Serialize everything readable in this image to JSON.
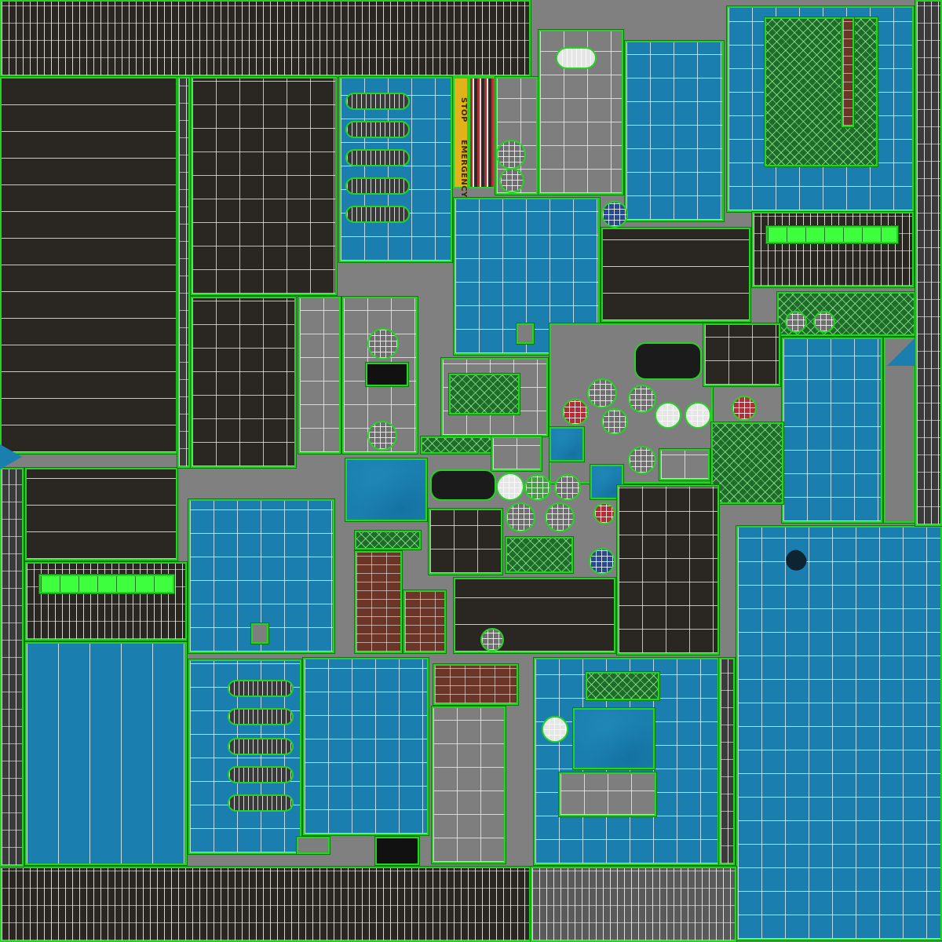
{
  "texture": {
    "label_stop": "STOP",
    "label_emergency": "EMERGENCY"
  },
  "colors": {
    "wire_green": "#23d423",
    "panel_blue": "#1a7fae",
    "panel_dark": "#2a2622",
    "panel_gray": "#7e7e7e",
    "warning_yellow": "#e2b21a",
    "brick_brown": "#6b3628",
    "mesh_green": "#1e6b2a",
    "bright_green": "#3dff3d"
  }
}
